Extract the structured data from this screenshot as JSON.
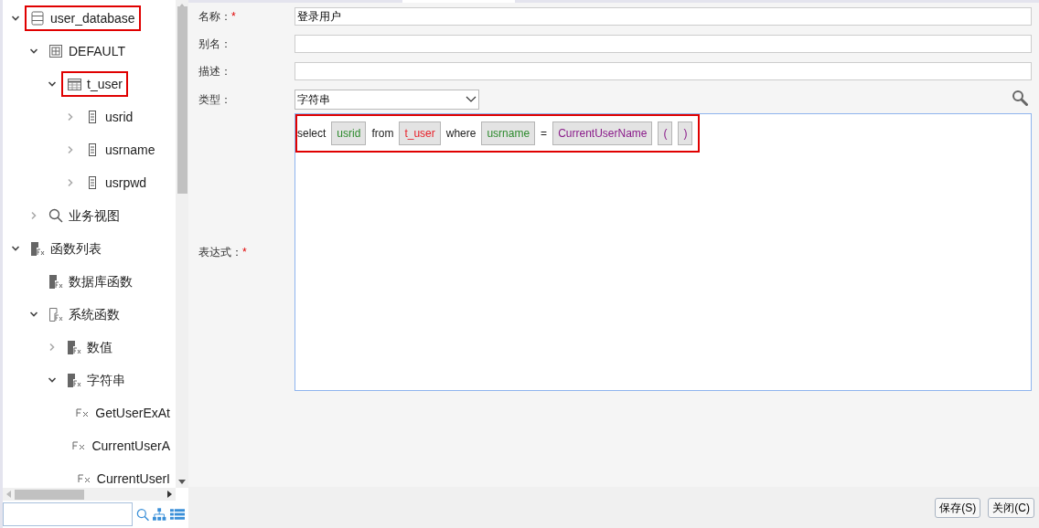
{
  "tree": [
    {
      "label": "user_database",
      "kind": "database",
      "expanded": true,
      "highlighted": true,
      "children": [
        {
          "label": "DEFAULT",
          "kind": "schema",
          "expanded": true,
          "highlighted": false,
          "children": [
            {
              "label": "t_user",
              "kind": "table",
              "expanded": true,
              "highlighted": true,
              "children": [
                {
                  "label": "usrid",
                  "kind": "column",
                  "expanded": false,
                  "highlighted": false
                },
                {
                  "label": "usrname",
                  "kind": "column",
                  "expanded": false,
                  "highlighted": false
                },
                {
                  "label": "usrpwd",
                  "kind": "column",
                  "expanded": false,
                  "highlighted": false
                }
              ]
            }
          ]
        },
        {
          "label": "业务视图",
          "kind": "search",
          "expanded": false,
          "highlighted": false
        }
      ]
    },
    {
      "label": "函数列表",
      "kind": "fx",
      "expanded": true,
      "highlighted": false,
      "children": [
        {
          "label": "数据库函数",
          "kind": "fx",
          "highlighted": false
        },
        {
          "label": "系统函数",
          "kind": "fx-outline",
          "expanded": true,
          "highlighted": false,
          "children": [
            {
              "label": "数值",
              "kind": "fx",
              "expanded": false,
              "highlighted": false
            },
            {
              "label": "字符串",
              "kind": "fx",
              "expanded": true,
              "highlighted": false,
              "children": [
                {
                  "label": "GetUserExAt",
                  "kind": "fx-small",
                  "highlighted": false
                },
                {
                  "label": "CurrentUserA",
                  "kind": "fx-small",
                  "highlighted": false
                },
                {
                  "label": "CurrentUserI",
                  "kind": "fx-small",
                  "highlighted": false
                }
              ]
            }
          ]
        }
      ]
    }
  ],
  "form": {
    "name": {
      "label": "名称：",
      "required_mark": "*",
      "value": "登录用户"
    },
    "alias": {
      "label": "别名："
    },
    "description": {
      "label": "描述："
    },
    "type": {
      "label": "类型：",
      "value": "字符串"
    },
    "expression": {
      "label": "表达式：",
      "required_mark": "*",
      "highlighted": true,
      "tokens": [
        {
          "kind": "keyword",
          "text": "select"
        },
        {
          "kind": "field",
          "text": "usrid"
        },
        {
          "kind": "keyword",
          "text": "from"
        },
        {
          "kind": "table",
          "text": "t_user"
        },
        {
          "kind": "keyword",
          "text": "where"
        },
        {
          "kind": "field",
          "text": "usrname"
        },
        {
          "kind": "keyword",
          "text": "="
        },
        {
          "kind": "function",
          "text": "CurrentUserName"
        },
        {
          "kind": "function",
          "text": "("
        },
        {
          "kind": "function",
          "text": ")"
        }
      ]
    }
  },
  "buttons": [
    "保存(S)",
    "关闭(C)"
  ]
}
